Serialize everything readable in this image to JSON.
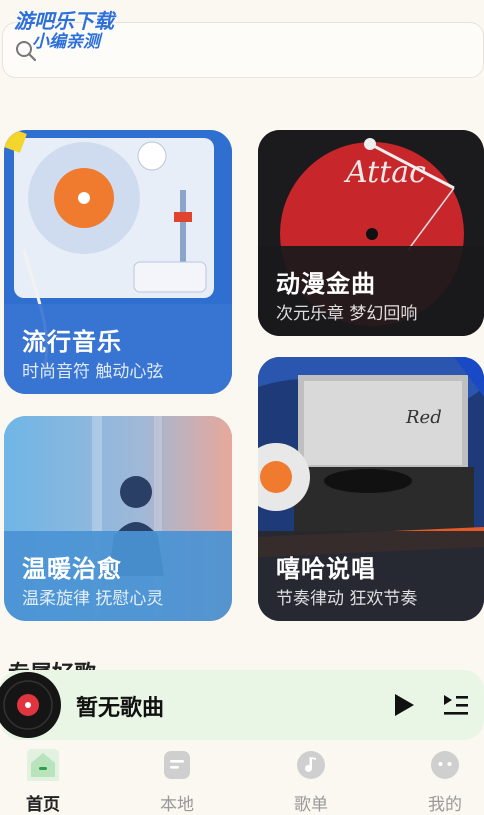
{
  "watermark": {
    "line1": "游吧乐下载",
    "line2": "小编亲测"
  },
  "search": {
    "placeholder": ""
  },
  "cards": {
    "pop": {
      "title": "流行音乐",
      "subtitle": "时尚音符 触动心弦"
    },
    "anime": {
      "title": "动漫金曲",
      "subtitle": "次元乐章 梦幻回响"
    },
    "heal": {
      "title": "温暖治愈",
      "subtitle": "温柔旋律 抚慰心灵"
    },
    "hiphop": {
      "title": "嘻哈说唱",
      "subtitle": "节奏律动 狂欢节奏"
    }
  },
  "section_peek": "专属好歌",
  "player": {
    "song": "暂无歌曲"
  },
  "tabs": [
    {
      "label": "首页",
      "icon": "home-icon",
      "active": true
    },
    {
      "label": "本地",
      "icon": "local-file-icon",
      "active": false
    },
    {
      "label": "歌单",
      "icon": "music-note-icon",
      "active": false
    },
    {
      "label": "我的",
      "icon": "profile-face-icon",
      "active": false
    }
  ],
  "colors": {
    "accent_green": "#2e9e4d",
    "player_bg": "#e9f6e6",
    "background": "#fbf8f2"
  }
}
